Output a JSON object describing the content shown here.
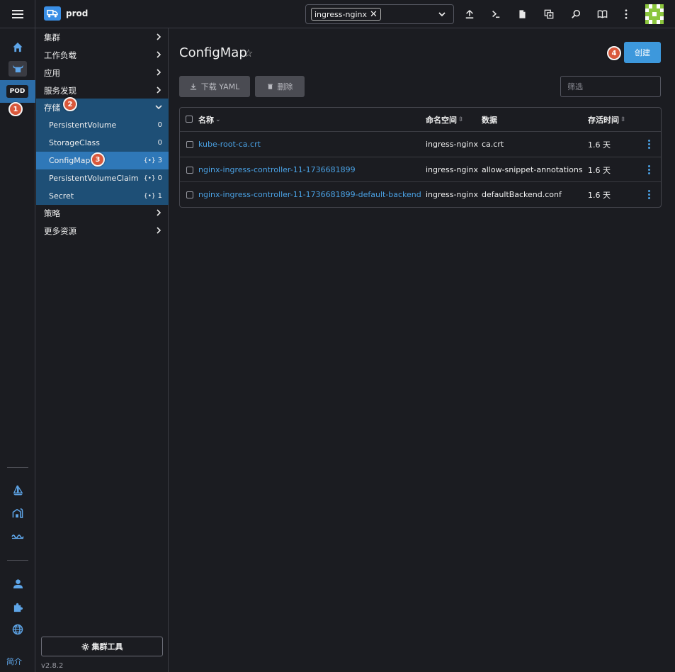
{
  "topbar": {
    "cluster_name": "prod",
    "namespace_chip": "ingress-nginx",
    "namespace_remove": "✕",
    "icons": [
      "upload-icon",
      "terminal-icon",
      "file-icon",
      "copy-icon",
      "search-icon",
      "book-icon",
      "more-icon"
    ]
  },
  "rail": {
    "pod_label": "POD",
    "bottom_label": "简介"
  },
  "nav": {
    "items": [
      {
        "label": "集群"
      },
      {
        "label": "工作负载"
      },
      {
        "label": "应用"
      },
      {
        "label": "服务发现"
      },
      {
        "label": "存储"
      },
      {
        "label": "策略"
      },
      {
        "label": "更多资源"
      }
    ],
    "storage_sub": [
      {
        "label": "PersistentVolume",
        "count": "0"
      },
      {
        "label": "StorageClass",
        "count": "0"
      },
      {
        "label": "ConfigMap",
        "count": "3"
      },
      {
        "label": "PersistentVolumeClaim",
        "count": "0"
      },
      {
        "label": "Secret",
        "count": "1"
      }
    ],
    "ns_symbol": "{•}",
    "cluster_tools": "集群工具",
    "version": "v2.8.2"
  },
  "main": {
    "title": "ConfigMap",
    "star": "☆",
    "create_label": "创建",
    "download_yaml": "下载 YAML",
    "delete_label": "删除",
    "filter_placeholder": "筛选",
    "columns": {
      "name": "名称",
      "namespace": "命名空间",
      "data": "数据",
      "age": "存活时间"
    },
    "rows": [
      {
        "name": "kube-root-ca.crt",
        "namespace": "ingress-nginx",
        "data": "ca.crt",
        "age": "1.6 天"
      },
      {
        "name": "nginx-ingress-controller-11-1736681899",
        "namespace": "ingress-nginx",
        "data": "allow-snippet-annotations",
        "age": "1.6 天"
      },
      {
        "name": "nginx-ingress-controller-11-1736681899-default-backend",
        "namespace": "ingress-nginx",
        "data": "defaultBackend.conf",
        "age": "1.6 天"
      }
    ]
  },
  "callouts": [
    "1",
    "2",
    "3",
    "4"
  ],
  "colors": {
    "accent": "#3d98dc",
    "nav_open": "#1e4f76",
    "nav_active": "#2f78b8",
    "link": "#4aa1e4",
    "callout": "#d9583b",
    "background": "#1b1c21"
  }
}
